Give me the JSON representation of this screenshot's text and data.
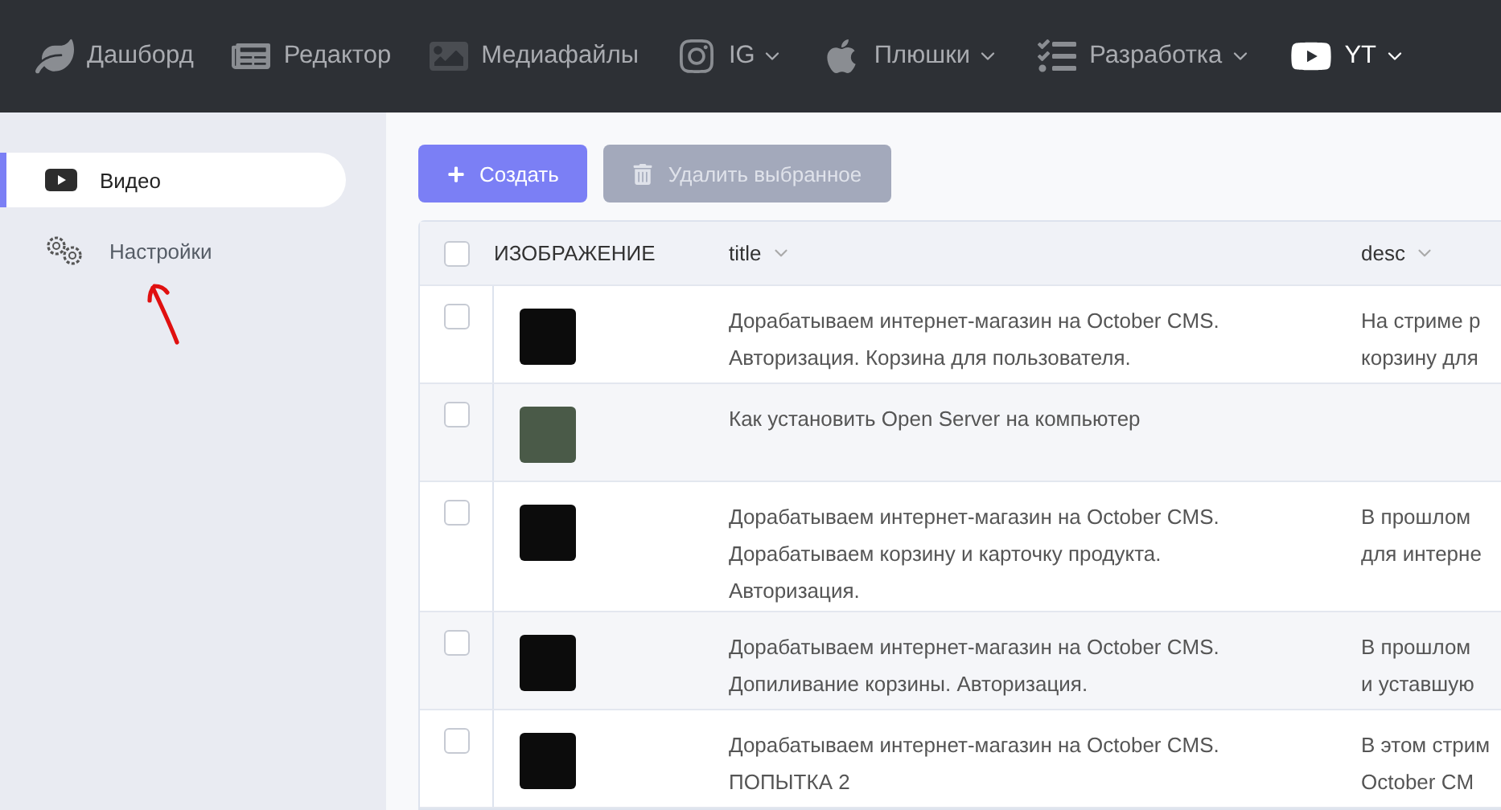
{
  "nav": [
    {
      "label": "Дашборд",
      "dropdown": false,
      "selected": false
    },
    {
      "label": "Редактор",
      "dropdown": false,
      "selected": false
    },
    {
      "label": "Медиафайлы",
      "dropdown": false,
      "selected": false
    },
    {
      "label": "IG",
      "dropdown": true,
      "selected": false
    },
    {
      "label": "Плюшки",
      "dropdown": true,
      "selected": false
    },
    {
      "label": "Разработка",
      "dropdown": true,
      "selected": false
    },
    {
      "label": "YT",
      "dropdown": true,
      "selected": true
    }
  ],
  "sidebar": {
    "items": [
      {
        "label": "Видео",
        "selected": true
      },
      {
        "label": "Настройки",
        "selected": false
      }
    ]
  },
  "toolbar": {
    "buttons": [
      {
        "label": "Создать",
        "kind": "create",
        "disabled": false
      },
      {
        "label": "Удалить выбранное",
        "kind": "delete",
        "disabled": true
      }
    ]
  },
  "table": {
    "select_all_checked": false,
    "columns": [
      {
        "label": "ИЗОБРАЖЕНИЕ",
        "sortable": false
      },
      {
        "label": "title",
        "sortable": true
      },
      {
        "label": "desc",
        "sortable": true
      }
    ],
    "rows": [
      {
        "checked": false,
        "title": [
          "Дорабатываем интернет-магазин на October CMS.",
          "Авторизация. Корзина для пользователя."
        ],
        "desc": [
          "На стриме р",
          "корзину для"
        ]
      },
      {
        "checked": false,
        "title": [
          "Как установить Open Server на компьютер"
        ],
        "desc": []
      },
      {
        "checked": false,
        "title": [
          "Дорабатываем интернет-магазин на October CMS.",
          "Дорабатываем корзину и карточку продукта.",
          "Авторизация."
        ],
        "desc": [
          "В прошлом",
          "для интерне"
        ]
      },
      {
        "checked": false,
        "title": [
          "Дорабатываем интернет-магазин на October CMS.",
          "Допиливание корзины. Авторизация."
        ],
        "desc": [
          "В прошлом",
          "и уставшую"
        ]
      },
      {
        "checked": false,
        "title": [
          "Дорабатываем интернет-магазин на October CMS.",
          "ПОПЫТКА 2"
        ],
        "desc": [
          "В этом стрим",
          "October CM"
        ]
      }
    ]
  }
}
